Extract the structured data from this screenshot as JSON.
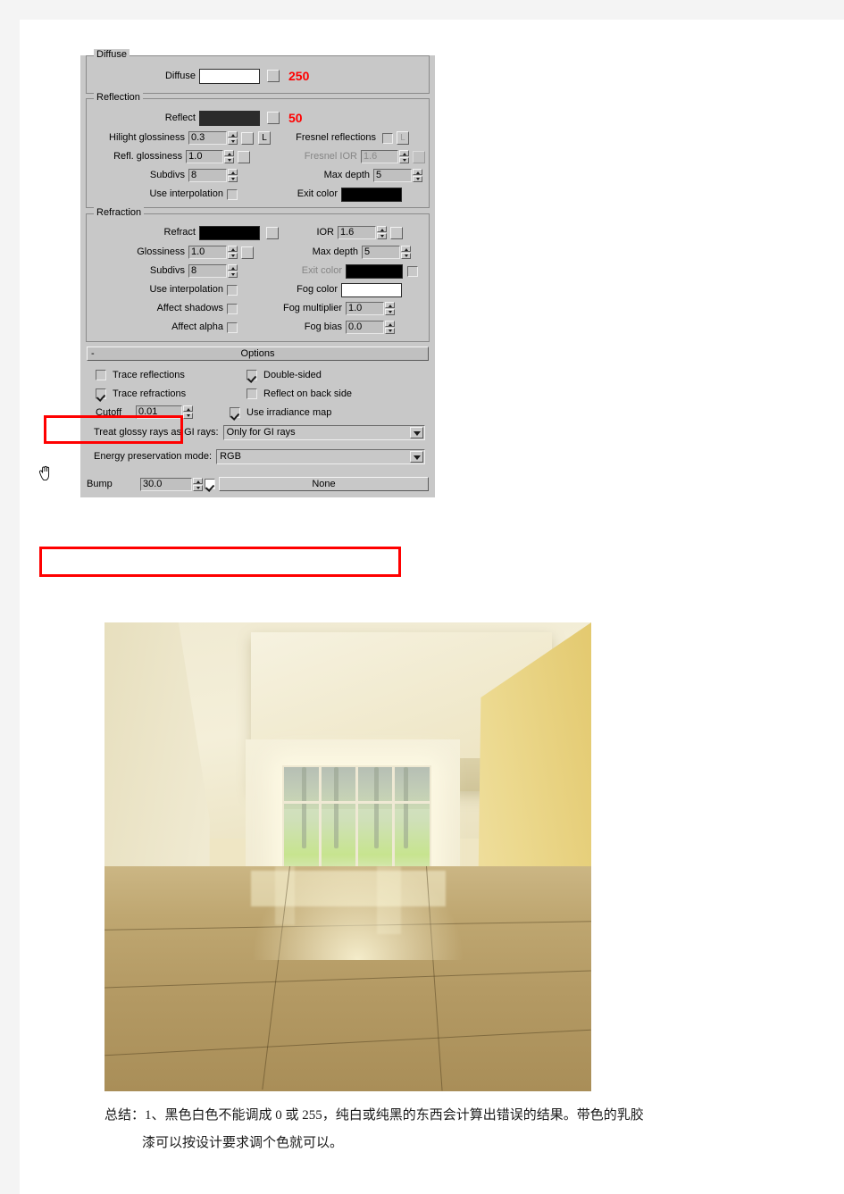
{
  "document": {
    "caption_line1": "总结：1、黑色白色不能调成 0 或 255，纯白或纯黑的东西会计算出错误的结果。带色的乳胶",
    "caption_line2": "漆可以按设计要求调个色就可以。",
    "caption_label": "总结："
  },
  "material_panel": {
    "diffuse": {
      "group_title": "Diffuse",
      "label": "Diffuse",
      "swatch_color": "#ffffff",
      "value_annotation": "250",
      "annotation_color": "#ff0000"
    },
    "reflection": {
      "group_title": "Reflection",
      "reflect_label": "Reflect",
      "reflect_swatch_color": "#2b2b2b",
      "reflect_annotation": "50",
      "hilight_glossiness_label": "Hilight glossiness",
      "hilight_glossiness_value": "0.3",
      "hilight_lock_label": "L",
      "fresnel_reflections_label": "Fresnel reflections",
      "fresnel_reflections_checked": false,
      "fresnel_lock_label": "L",
      "refl_glossiness_label": "Refl. glossiness",
      "refl_glossiness_value": "1.0",
      "fresnel_ior_label": "Fresnel IOR",
      "fresnel_ior_value": "1.6",
      "subdivs_label": "Subdivs",
      "subdivs_value": "8",
      "max_depth_label": "Max depth",
      "max_depth_value": "5",
      "use_interpolation_label": "Use interpolation",
      "use_interpolation_checked": false,
      "exit_color_label": "Exit color",
      "exit_color_swatch": "#000000"
    },
    "refraction": {
      "group_title": "Refraction",
      "refract_label": "Refract",
      "refract_swatch_color": "#000000",
      "ior_label": "IOR",
      "ior_value": "1.6",
      "glossiness_label": "Glossiness",
      "glossiness_value": "1.0",
      "max_depth_label": "Max depth",
      "max_depth_value": "5",
      "subdivs_label": "Subdivs",
      "subdivs_value": "8",
      "exit_color_label": "Exit color",
      "exit_color_swatch": "#000000",
      "exit_color_checked": false,
      "use_interpolation_label": "Use interpolation",
      "use_interpolation_checked": false,
      "fog_color_label": "Fog color",
      "fog_color_swatch": "#ffffff",
      "affect_shadows_label": "Affect shadows",
      "affect_shadows_checked": false,
      "fog_multiplier_label": "Fog multiplier",
      "fog_multiplier_value": "1.0",
      "affect_alpha_label": "Affect alpha",
      "affect_alpha_checked": false,
      "fog_bias_label": "Fog bias",
      "fog_bias_value": "0.0"
    },
    "options": {
      "rollout_title": "Options",
      "rollout_toggle": "-",
      "trace_reflections_label": "Trace reflections",
      "trace_reflections_checked": false,
      "double_sided_label": "Double-sided",
      "double_sided_checked": true,
      "trace_refractions_label": "Trace refractions",
      "trace_refractions_checked": true,
      "reflect_on_back_side_label": "Reflect on back side",
      "reflect_on_back_side_checked": false,
      "cutoff_label": "Cutoff",
      "cutoff_value": "0.01",
      "use_irradiance_map_label": "Use irradiance map",
      "use_irradiance_map_checked": true,
      "treat_glossy_label": "Treat glossy rays as GI rays:",
      "treat_glossy_value": "Only for GI rays",
      "energy_preservation_label": "Energy preservation mode:",
      "energy_preservation_value": "RGB"
    },
    "maps": {
      "bump_label": "Bump",
      "bump_amount": "30.0",
      "bump_enabled": true,
      "bump_map_button": "None"
    },
    "highlight_color": "#ff0000"
  }
}
